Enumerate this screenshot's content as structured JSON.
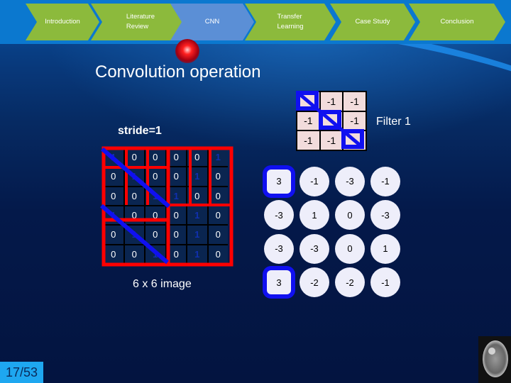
{
  "nav": {
    "items": [
      {
        "label_lines": [
          "Introduction"
        ],
        "state": "inactive"
      },
      {
        "label_lines": [
          "Literature",
          "Review"
        ],
        "state": "inactive"
      },
      {
        "label_lines": [
          "CNN"
        ],
        "state": "active"
      },
      {
        "label_lines": [
          "Transfer",
          "Learning"
        ],
        "state": "inactive"
      },
      {
        "label_lines": [
          "Case Study"
        ],
        "state": "inactive"
      },
      {
        "label_lines": [
          "Conclusion"
        ],
        "state": "inactive"
      }
    ]
  },
  "slide": {
    "title": "Convolution operation",
    "stride_label": "stride=1",
    "filter_label": "Filter 1",
    "image_caption": "6 x 6 image",
    "image_grid": [
      [
        "1",
        "0",
        "0",
        "0",
        "0",
        "1"
      ],
      [
        "0",
        "1",
        "0",
        "0",
        "1",
        "0"
      ],
      [
        "0",
        "0",
        "1",
        "1",
        "0",
        "0"
      ],
      [
        "1",
        "0",
        "0",
        "0",
        "1",
        "0"
      ],
      [
        "0",
        "1",
        "0",
        "0",
        "1",
        "0"
      ],
      [
        "0",
        "0",
        "1",
        "0",
        "1",
        "0"
      ]
    ],
    "filter_grid": [
      [
        "1",
        "-1",
        "-1"
      ],
      [
        "-1",
        "1",
        "-1"
      ],
      [
        "-1",
        "-1",
        "1"
      ]
    ],
    "output_grid": [
      [
        "3",
        "-1",
        "-3",
        "-1"
      ],
      [
        "-3",
        "1",
        "0",
        "-3"
      ],
      [
        "-3",
        "-3",
        "0",
        "1"
      ],
      [
        "3",
        "-2",
        "-2",
        "-1"
      ]
    ],
    "highlighted_outputs": [
      [
        0,
        0
      ],
      [
        3,
        0
      ]
    ]
  },
  "footer": {
    "page_current": "17",
    "page_total": "53",
    "page_label": "17/53"
  },
  "colors": {
    "nav_green": "#8cba3c",
    "nav_active": "#5b8fd6",
    "highlight_red": "#ff0000",
    "highlight_blue": "#1010f0",
    "page_badge": "#1ea7f0"
  }
}
